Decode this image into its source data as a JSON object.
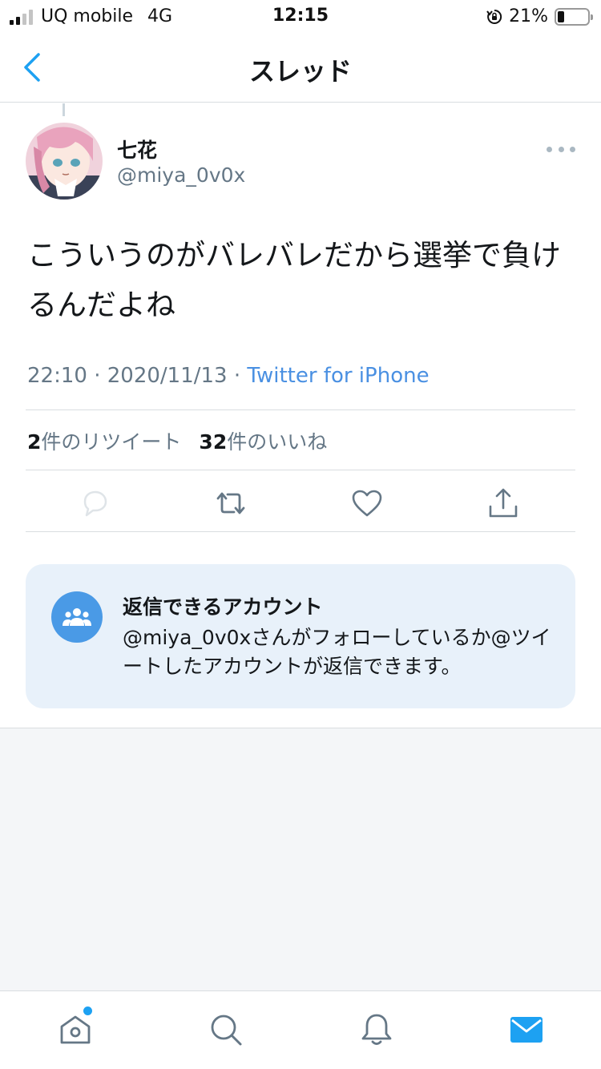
{
  "status_bar": {
    "carrier": "UQ mobile",
    "network": "4G",
    "time": "12:15",
    "battery_text": "21%",
    "battery_level": 0.21,
    "signal_bars": 2
  },
  "nav": {
    "title": "スレッド",
    "back_icon": "chevron-left-icon"
  },
  "tweet": {
    "display_name": "七花",
    "handle": "@miya_0v0x",
    "text": "こういうのがバレバレだから選挙で負けるんだよね",
    "time": "22:10",
    "date": "2020/11/13",
    "separator": "·",
    "source": "Twitter for iPhone",
    "retweet_count": "2",
    "retweet_label": "件のリツイート",
    "like_count": "32",
    "like_label": "件のいいね"
  },
  "actions": [
    {
      "name": "reply",
      "icon": "reply-bubble-icon"
    },
    {
      "name": "retweet",
      "icon": "retweet-icon"
    },
    {
      "name": "like",
      "icon": "heart-icon"
    },
    {
      "name": "share",
      "icon": "share-icon"
    }
  ],
  "reply_notice": {
    "title": "返信できるアカウント",
    "description": "@miya_0v0xさんがフォローしているか@ツイートしたアカウントが返信できます。",
    "icon": "people-group-icon"
  },
  "tab_bar": [
    {
      "name": "home",
      "icon": "home-icon",
      "has_notification_dot": true
    },
    {
      "name": "search",
      "icon": "search-icon"
    },
    {
      "name": "notifications",
      "icon": "bell-icon"
    },
    {
      "name": "messages",
      "icon": "envelope-icon",
      "active": true
    }
  ],
  "colors": {
    "accent": "#1da1f2",
    "link": "#4a90e2",
    "muted_text": "#657786",
    "notice_bg": "#e8f1fa"
  }
}
